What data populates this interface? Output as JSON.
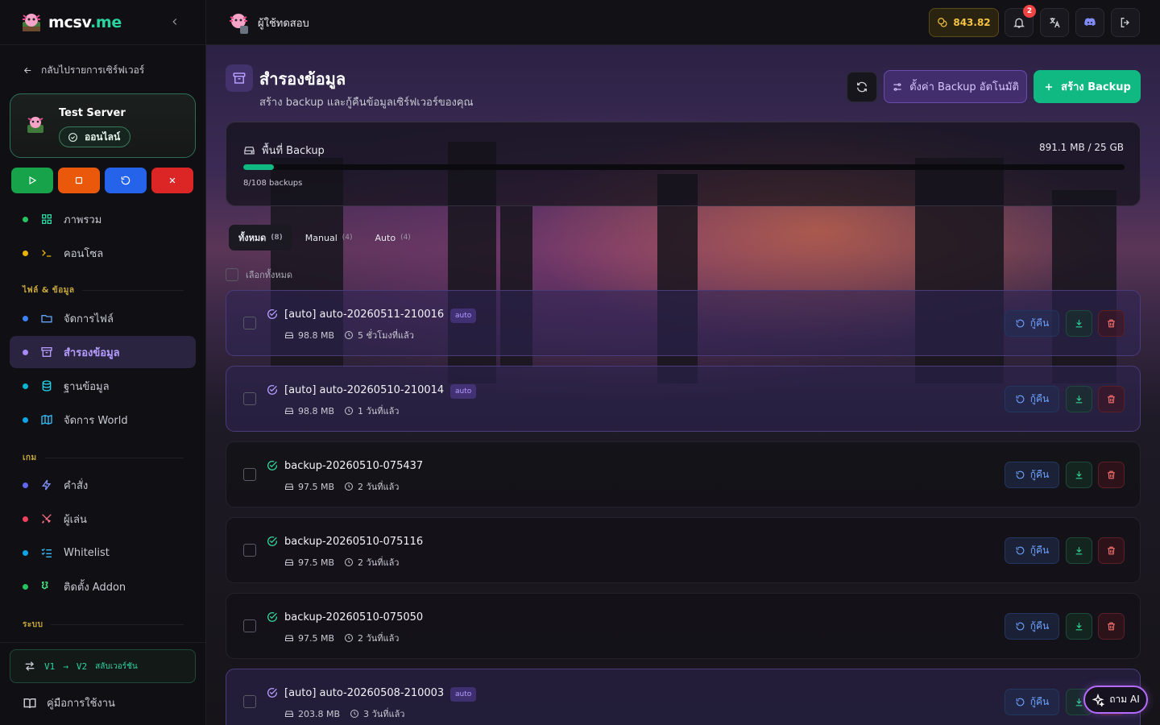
{
  "brand": {
    "name_main": "mcsv",
    "name_tld": ".me"
  },
  "sidebar": {
    "back_label": "กลับไปรายการเซิร์ฟเวอร์",
    "server": {
      "name": "Test Server",
      "status": "ออนไลน์"
    },
    "nav_main": [
      {
        "label": "ภาพรวม",
        "dot": "#22c55e"
      },
      {
        "label": "คอนโซล",
        "dot": "#eab308"
      }
    ],
    "section_files": "ไฟล์ & ข้อมูล",
    "nav_files": [
      {
        "label": "จัดการไฟล์",
        "dot": "#3b82f6"
      },
      {
        "label": "สำรองข้อมูล",
        "dot": "#a78bfa"
      },
      {
        "label": "ฐานข้อมูล",
        "dot": "#06b6d4"
      },
      {
        "label": "จัดการ World",
        "dot": "#0ea5e9"
      }
    ],
    "section_game": "เกม",
    "nav_game": [
      {
        "label": "คำสั่ง",
        "dot": "#6366f1"
      },
      {
        "label": "ผู้เล่น",
        "dot": "#f43f5e"
      },
      {
        "label": "Whitelist",
        "dot": "#0ea5e9"
      },
      {
        "label": "ติดตั้ง Addon",
        "dot": "#22c55e"
      }
    ],
    "section_system": "ระบบ",
    "version_switch": {
      "from": "V1",
      "to": "V2",
      "label": "สลับเวอร์ชัน"
    },
    "manual": "คู่มือการใช้งาน"
  },
  "topbar": {
    "username": "ผู้ใช้ทดสอบ",
    "coins": "843.82",
    "notifications": "2"
  },
  "page": {
    "title": "สำรองข้อมูล",
    "subtitle": "สร้าง backup และกู้คืนข้อมูลเซิร์ฟเวอร์ของคุณ",
    "auto_label": "ตั้งค่า Backup อัตโนมัติ",
    "create_label": "สร้าง Backup"
  },
  "storage": {
    "title": "พื้นที่ Backup",
    "usage": "891.1 MB / 25 GB",
    "count": "8/108 backups",
    "used_fraction": 0.035
  },
  "tabs": [
    {
      "label": "ทั้งหมด",
      "count": "(8)"
    },
    {
      "label": "Manual",
      "count": "(4)"
    },
    {
      "label": "Auto",
      "count": "(4)"
    }
  ],
  "select_all": "เลือกทั้งหมด",
  "auto_tag": "auto",
  "restore_label": "กู้คืน",
  "backups": [
    {
      "name": "[auto] auto-20260511-210016",
      "size": "98.8 MB",
      "time": "5 ชั่วโมงที่แล้ว",
      "auto": true
    },
    {
      "name": "[auto] auto-20260510-210014",
      "size": "98.8 MB",
      "time": "1 วันที่แล้ว",
      "auto": true
    },
    {
      "name": "backup-20260510-075437",
      "size": "97.5 MB",
      "time": "2 วันที่แล้ว",
      "auto": false
    },
    {
      "name": "backup-20260510-075116",
      "size": "97.5 MB",
      "time": "2 วันที่แล้ว",
      "auto": false
    },
    {
      "name": "backup-20260510-075050",
      "size": "97.5 MB",
      "time": "2 วันที่แล้ว",
      "auto": false
    },
    {
      "name": "[auto] auto-20260508-210003",
      "size": "203.8 MB",
      "time": "3 วันที่แล้ว",
      "auto": true
    }
  ],
  "ask_ai": "ถาม AI"
}
